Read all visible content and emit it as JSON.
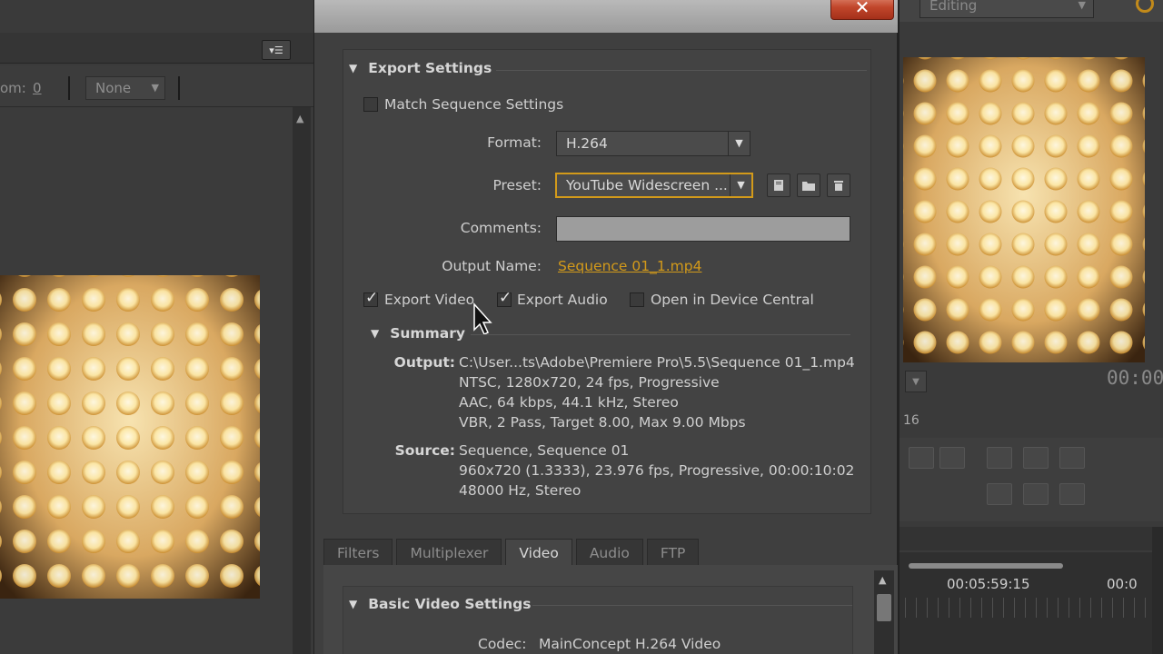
{
  "left_panel": {
    "zoom_label": "om:",
    "zoom_value": "0",
    "select_value": "None"
  },
  "right_panel": {
    "workspace": "Editing",
    "timecode_top": "00:00",
    "frame_label": "16",
    "timecode_cursor": "00:05:59:15",
    "timecode_right": "00:0"
  },
  "dialog": {
    "export_settings": {
      "title": "Export Settings",
      "match_sequence": "Match Sequence Settings",
      "format_label": "Format:",
      "format_value": "H.264",
      "preset_label": "Preset:",
      "preset_value": "YouTube Widescreen ...",
      "comments_label": "Comments:",
      "comments_value": "",
      "output_name_label": "Output Name:",
      "output_name_value": "Sequence 01_1.mp4",
      "export_video": "Export Video",
      "export_audio": "Export Audio",
      "device_central": "Open in Device Central"
    },
    "summary": {
      "title": "Summary",
      "output_key": "Output:",
      "output_lines": [
        "C:\\User...ts\\Adobe\\Premiere Pro\\5.5\\Sequence 01_1.mp4",
        "NTSC, 1280x720, 24 fps, Progressive",
        "AAC, 64 kbps, 44.1 kHz, Stereo",
        "VBR, 2 Pass, Target 8.00, Max 9.00 Mbps"
      ],
      "source_key": "Source:",
      "source_lines": [
        "Sequence, Sequence 01",
        "960x720 (1.3333), 23.976 fps, Progressive, 00:00:10:02",
        "48000 Hz, Stereo"
      ]
    },
    "tabs": [
      "Filters",
      "Multiplexer",
      "Video",
      "Audio",
      "FTP"
    ],
    "basic_video": {
      "title": "Basic Video Settings",
      "codec_label": "Codec:",
      "codec_value": "MainConcept H.264 Video"
    }
  },
  "colors": {
    "accent": "#d39a1a",
    "close_button": "#c1462b"
  }
}
